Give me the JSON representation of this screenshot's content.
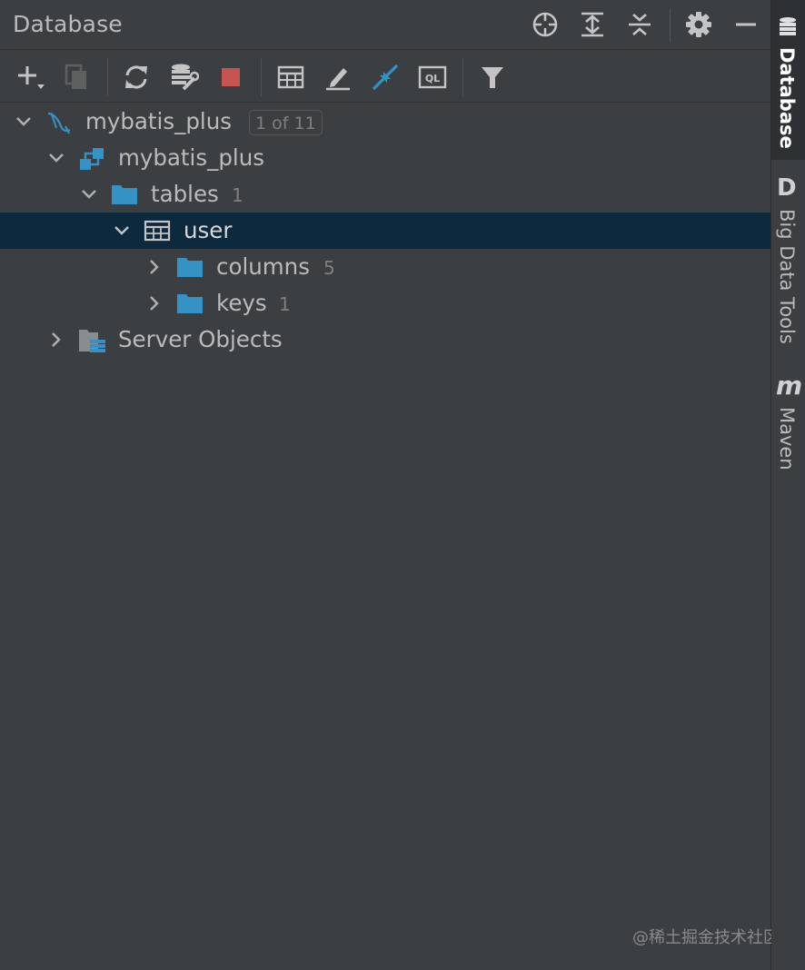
{
  "header": {
    "title": "Database"
  },
  "toolbar": {
    "icons": [
      "add-icon",
      "duplicate-icon",
      "refresh-icon",
      "data-source-properties-icon",
      "stop-icon",
      "table-view-icon",
      "edit-icon",
      "jump-to-console-icon",
      "ql-console-icon",
      "filter-icon"
    ]
  },
  "tree": {
    "data_source": {
      "label": "mybatis_plus",
      "badge": "1 of 11"
    },
    "schema": {
      "label": "mybatis_plus"
    },
    "tables": {
      "label": "tables",
      "count": "1"
    },
    "user": {
      "label": "user"
    },
    "columns": {
      "label": "columns",
      "count": "5"
    },
    "keys": {
      "label": "keys",
      "count": "1"
    },
    "server_objects": {
      "label": "Server Objects"
    }
  },
  "sidebar": {
    "database": {
      "label": "Database"
    },
    "bigdata": {
      "label": "Big Data Tools",
      "glyph": "D"
    },
    "maven": {
      "label": "Maven",
      "glyph": "m"
    }
  },
  "colors": {
    "background": "#3c3f41",
    "selection": "#0d293e",
    "accent_blue": "#3592c4",
    "stop_red": "#c75450"
  },
  "watermark": "@稀土掘金技术社区"
}
